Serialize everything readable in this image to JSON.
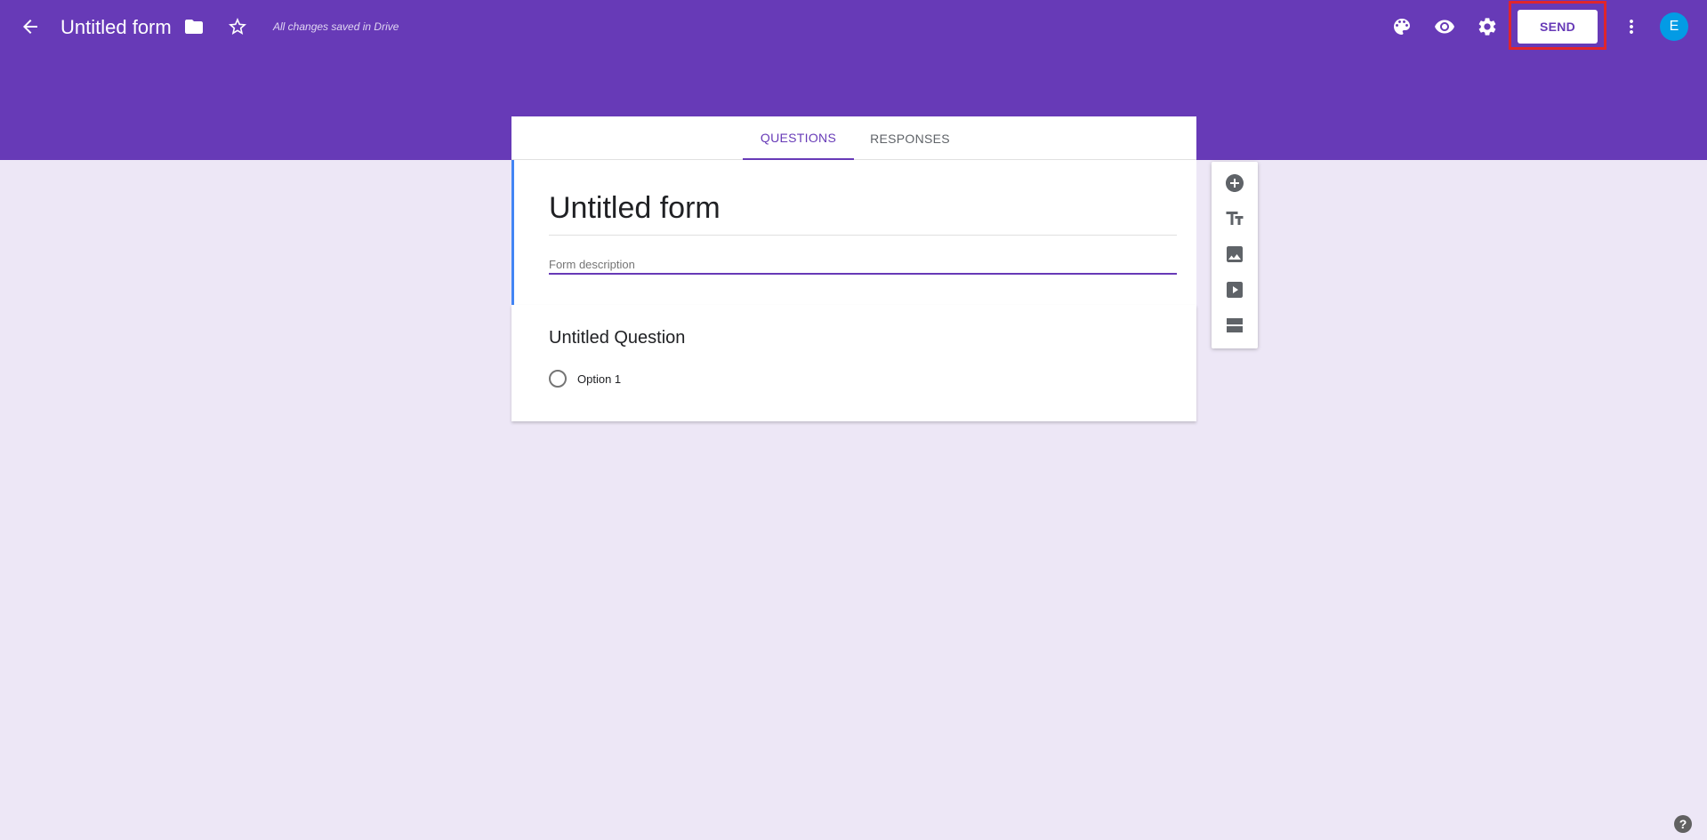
{
  "header": {
    "doc_title": "Untitled form",
    "save_status": "All changes saved in Drive",
    "send_label": "SEND",
    "avatar_initial": "E",
    "color": "#673ab7"
  },
  "tabs": [
    {
      "label": "QUESTIONS",
      "active": true
    },
    {
      "label": "RESPONSES",
      "active": false
    }
  ],
  "form": {
    "title": "Untitled form",
    "description_placeholder": "Form description"
  },
  "question": {
    "title": "Untitled Question",
    "options": [
      "Option 1"
    ]
  },
  "toolbar": {
    "items": [
      "add-question-icon",
      "title-text-icon",
      "image-icon",
      "video-icon",
      "section-icon"
    ]
  },
  "help": {
    "label": "?"
  },
  "colors": {
    "accent": "#673ab7",
    "background": "#ede7f6",
    "highlight": "#e0252c",
    "avatar": "#039be5"
  }
}
